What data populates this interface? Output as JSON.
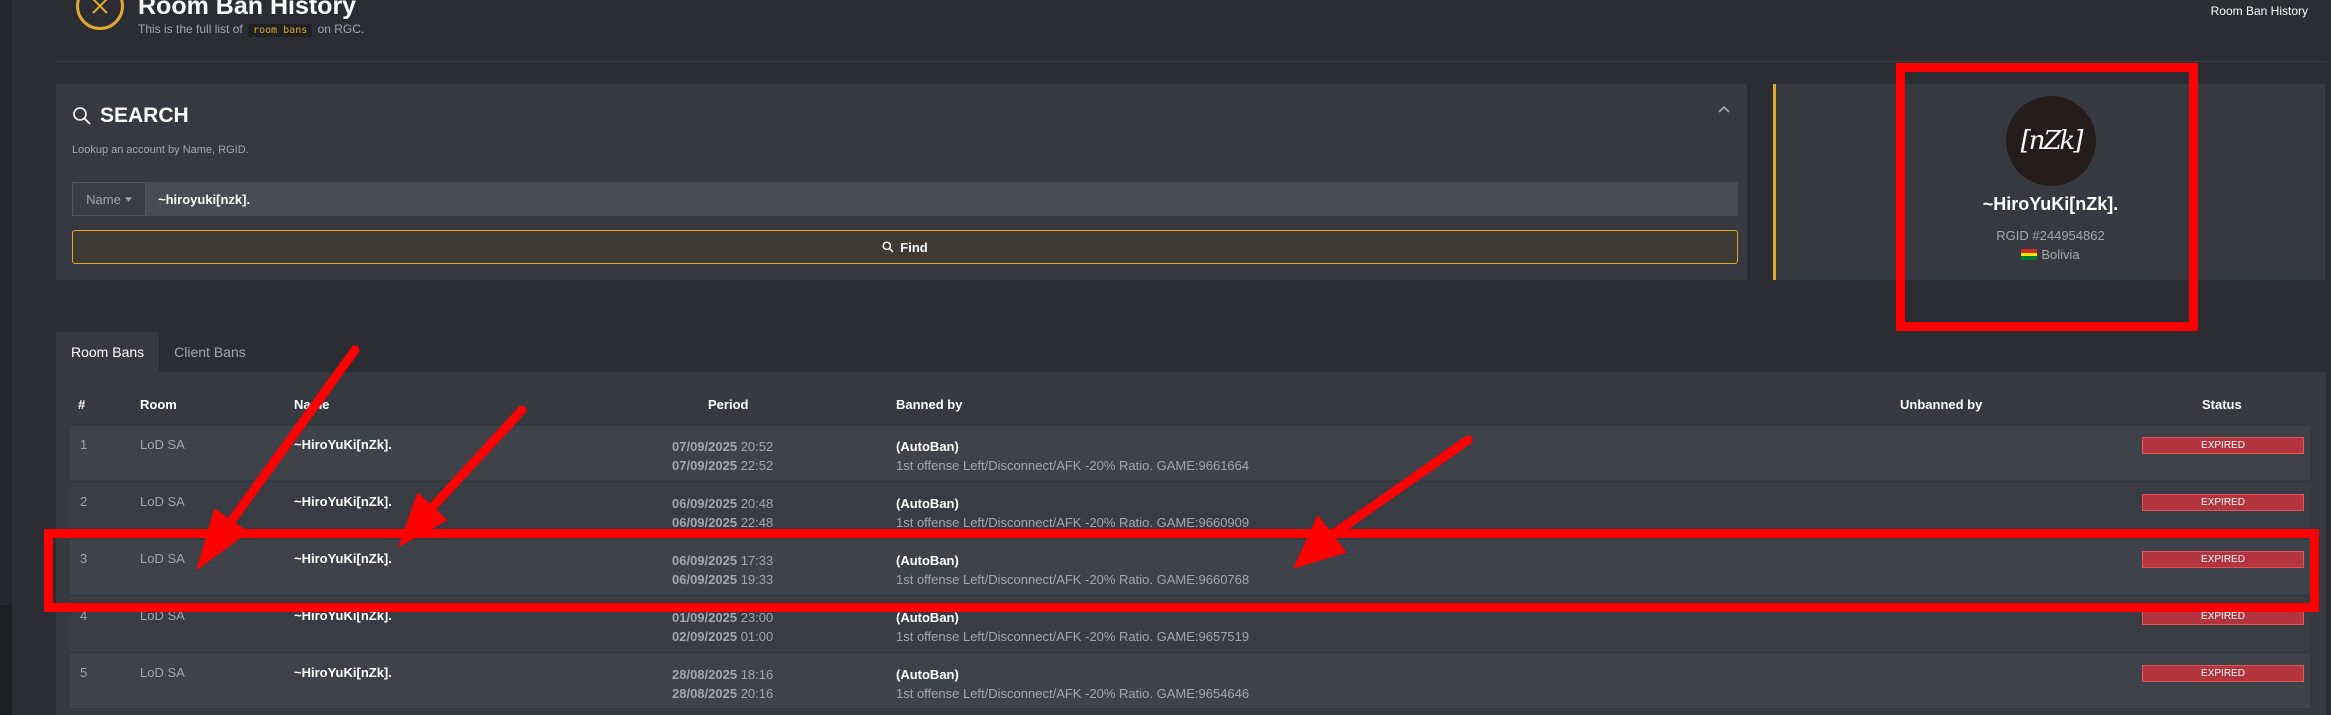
{
  "header": {
    "title": "Room Ban History",
    "subtitle_before": "This is the full list of",
    "subtitle_code": "room bans",
    "subtitle_after": "on RGC.",
    "breadcrumb_current": "Room Ban History",
    "icon": "x-circle-icon",
    "accent_color": "#e0a82e"
  },
  "search": {
    "title": "SEARCH",
    "description": "Lookup an account by Name, RGID.",
    "select_value": "Name",
    "input_value": "~hiroyuki[nzk].",
    "find_label": "Find"
  },
  "profile": {
    "avatar_text": "[nZk]",
    "name": "~HiroYuKi[nZk].",
    "rgid": "RGID #244954862",
    "country": "Bolivia"
  },
  "tabs": [
    {
      "label": "Room Bans",
      "active": true
    },
    {
      "label": "Client Bans",
      "active": false
    }
  ],
  "table": {
    "headers": {
      "num": "#",
      "room": "Room",
      "name": "Name",
      "period": "Period",
      "banned_by": "Banned by",
      "unbanned_by": "Unbanned by",
      "status": "Status"
    },
    "rows": [
      {
        "num": "1",
        "room": "LoD SA",
        "name": "~HiroYuKi[nZk].",
        "start_date": "07/09/2025",
        "start_time": "20:52",
        "end_date": "07/09/2025",
        "end_time": "22:52",
        "banned_by": "(AutoBan)",
        "reason": "1st offense Left/Disconnect/AFK -20% Ratio. GAME:9661664",
        "status": "EXPIRED"
      },
      {
        "num": "2",
        "room": "LoD SA",
        "name": "~HiroYuKi[nZk].",
        "start_date": "06/09/2025",
        "start_time": "20:48",
        "end_date": "06/09/2025",
        "end_time": "22:48",
        "banned_by": "(AutoBan)",
        "reason": "1st offense Left/Disconnect/AFK -20% Ratio. GAME:9660909",
        "status": "EXPIRED"
      },
      {
        "num": "3",
        "room": "LoD SA",
        "name": "~HiroYuKi[nZk].",
        "start_date": "06/09/2025",
        "start_time": "17:33",
        "end_date": "06/09/2025",
        "end_time": "19:33",
        "banned_by": "(AutoBan)",
        "reason": "1st offense Left/Disconnect/AFK -20% Ratio. GAME:9660768",
        "status": "EXPIRED"
      },
      {
        "num": "4",
        "room": "LoD SA",
        "name": "~HiroYuKi[nZk].",
        "start_date": "01/09/2025",
        "start_time": "23:00",
        "end_date": "02/09/2025",
        "end_time": "01:00",
        "banned_by": "(AutoBan)",
        "reason": "1st offense Left/Disconnect/AFK -20% Ratio. GAME:9657519",
        "status": "EXPIRED"
      },
      {
        "num": "5",
        "room": "LoD SA",
        "name": "~HiroYuKi[nZk].",
        "start_date": "28/08/2025",
        "start_time": "18:16",
        "end_date": "28/08/2025",
        "end_time": "20:16",
        "banned_by": "(AutoBan)",
        "reason": "1st offense Left/Disconnect/AFK -20% Ratio. GAME:9654646",
        "status": "EXPIRED"
      }
    ]
  },
  "colors": {
    "background": "#2b2d33",
    "panel": "#373941",
    "expired_badge": "#b4343e",
    "annotation": "#ff0000"
  }
}
